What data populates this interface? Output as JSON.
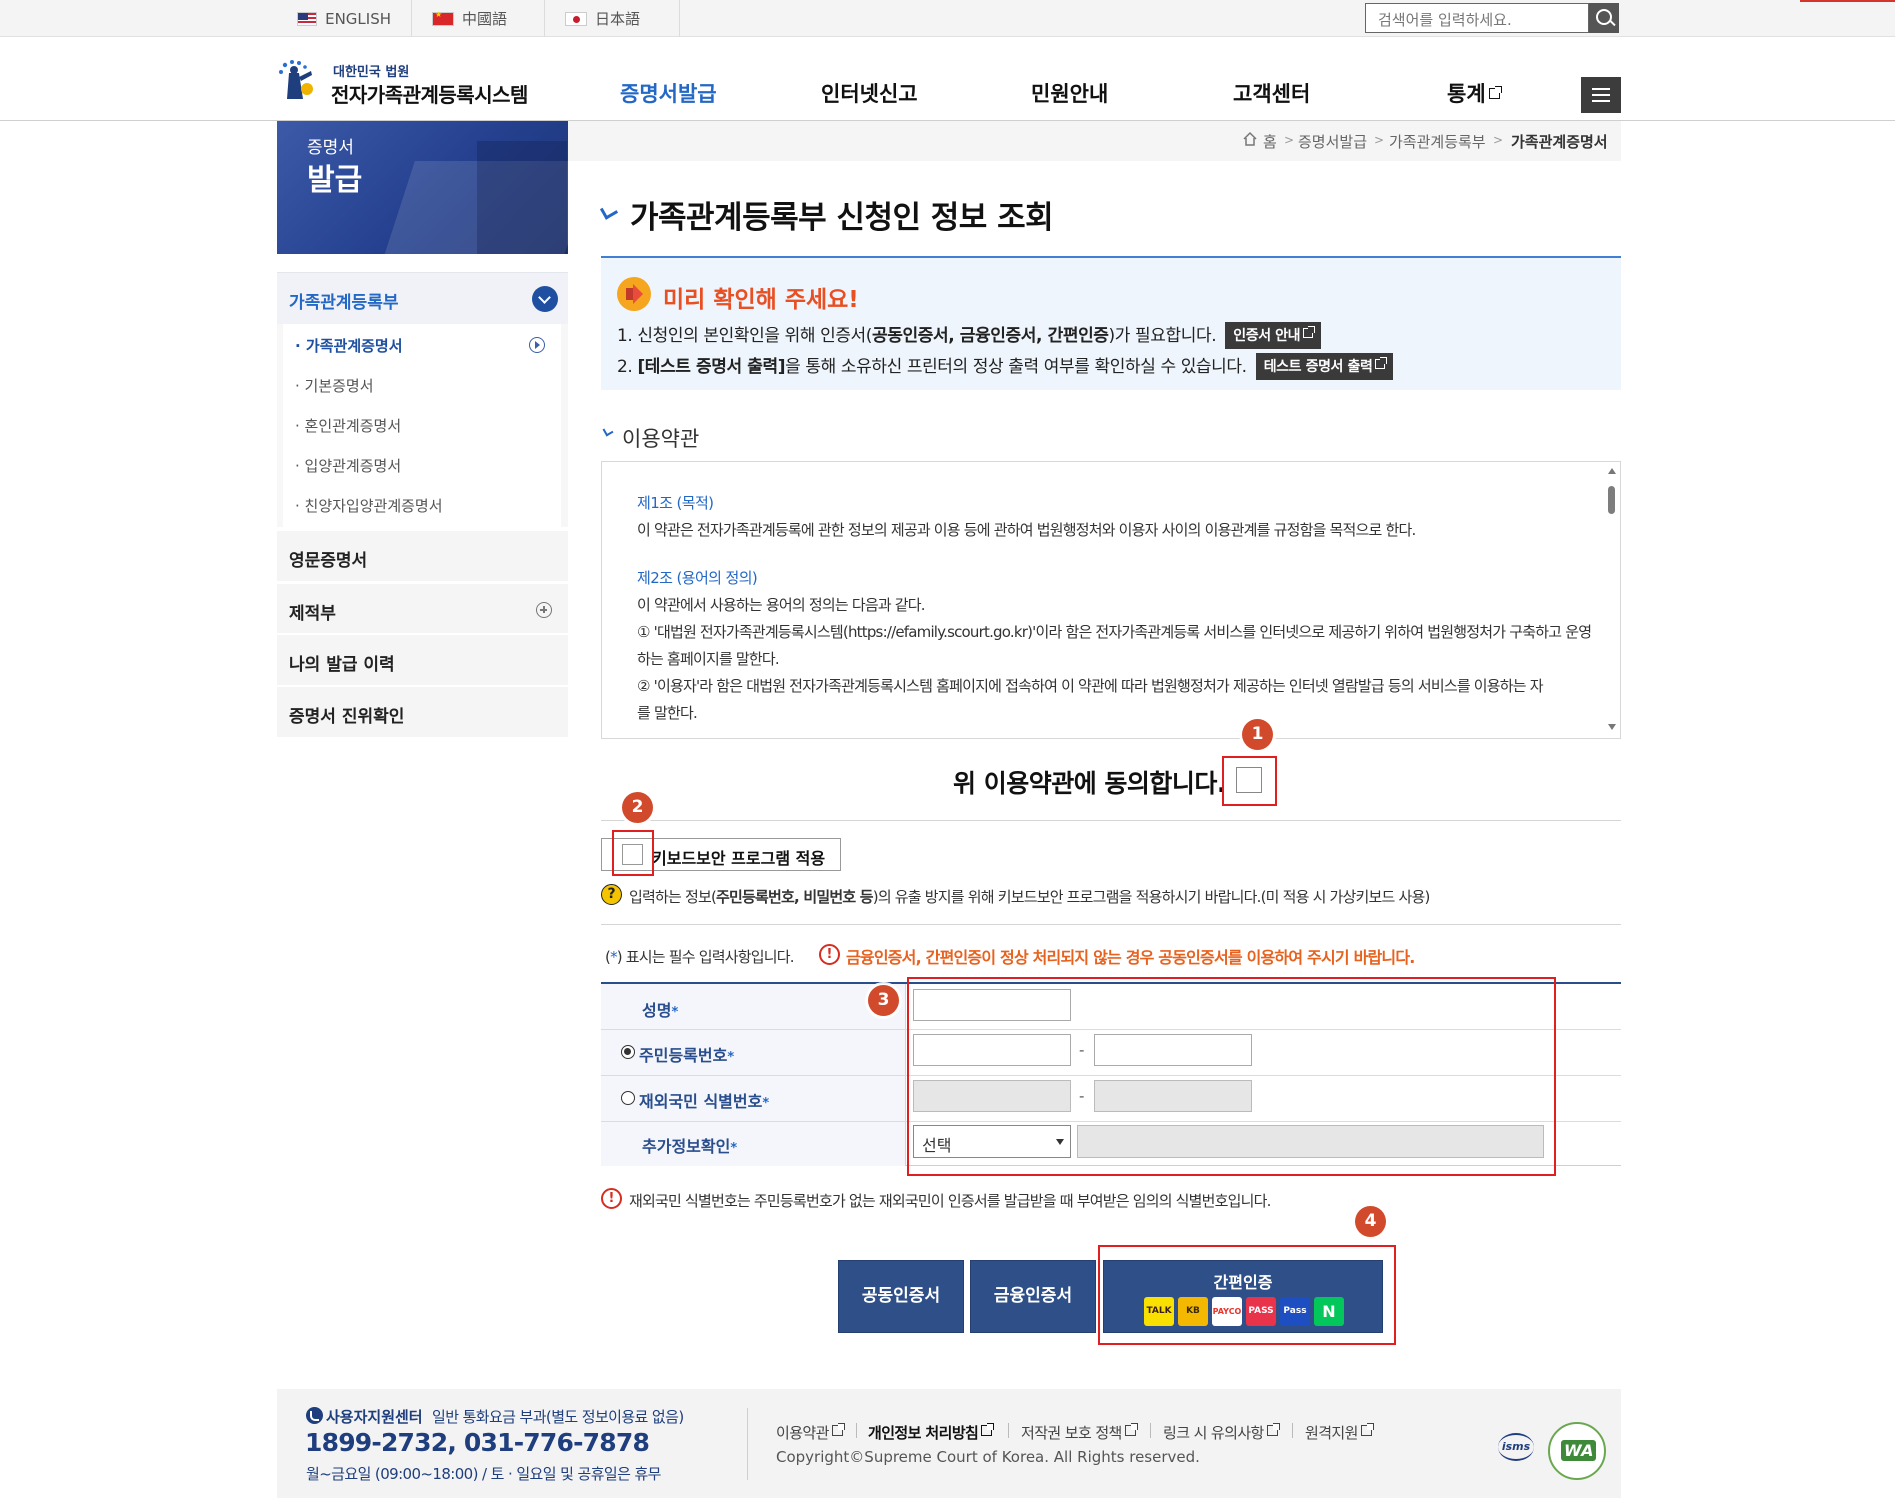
{
  "colors": {
    "brand_blue": "#2468c6",
    "navy": "#2a4e8c",
    "button_blue": "#2e4f88",
    "warning_orange": "#e8621f",
    "annotation_red": "#e02020"
  },
  "topbar": {
    "languages": [
      "ENGLISH",
      "中國語",
      "日本語"
    ],
    "search_placeholder": "검색어를 입력하세요."
  },
  "header": {
    "logo_sub": "대한민국 법원",
    "logo_title": "전자가족관계등록시스템",
    "nav": [
      "증명서발급",
      "인터넷신고",
      "민원안내",
      "고객센터",
      "통계"
    ]
  },
  "sidebar": {
    "banner_line1": "증명서",
    "banner_line2": "발급",
    "group": "가족관계등록부",
    "sub_items": [
      "· 가족관계증명서",
      "· 기본증명서",
      "· 혼인관계증명서",
      "· 입양관계증명서",
      "· 친양자입양관계증명서"
    ],
    "main_items": [
      "영문증명서",
      "제적부",
      "나의 발급 이력",
      "증명서 진위확인"
    ]
  },
  "breadcrumb": [
    "홈",
    "증명서발급",
    "가족관계등록부",
    "가족관계증명서"
  ],
  "page_title": "가족관계등록부 신청인 정보 조회",
  "notice": {
    "title": "미리 확인해 주세요!",
    "line1_a": "1. 신청인의 본인확인을 위해 인증서(",
    "line1_b": "공동인증서, 금융인증서, 간편인증",
    "line1_c": ")가 필요합니다.",
    "line1_btn": "인증서 안내",
    "line2_a": "2. ",
    "line2_b": "[테스트 증명서 출력]",
    "line2_c": "을 통해 소유하신 프린터의 정상 출력 여부를 확인하실 수 있습니다.",
    "line2_btn": "테스트 증명서 출력"
  },
  "terms": {
    "section_title": "이용약관",
    "art1_title": "제1조 (목적)",
    "art1_text": "이 약관은 전자가족관계등록에 관한 정보의 제공과 이용 등에 관하여 법원행정처와 이용자 사이의 이용관계를 규정함을 목적으로 한다.",
    "art2_title": "제2조 (용어의 정의)",
    "art2_intro": "이 약관에서 사용하는 용어의 정의는 다음과 같다.",
    "art2_item1_a": "① '대법원 전자가족관계등록시스템(https://efamily.scourt.go.kr)'이라 함은 전자가족관계등록 서비스를 인터넷으로 제공하기 위하여 법원행정처가 구축하고 운영",
    "art2_item1_b": "하는 홈페이지를 말한다.",
    "art2_item2_a": "② '이용자'라 함은 대법원 전자가족관계등록시스템 홈페이지에 접속하여 이 약관에 따라 법원행정처가 제공하는 인터넷 열람발급 등의 서비스를 이용하는 자",
    "art2_item2_b": "를 말한다."
  },
  "agree_label": "위 이용약관에 동의합니다.",
  "keyboard": {
    "label": "키보드보안 프로그램 적용",
    "note_a": "입력하는 정보(",
    "note_b": "주민등록번호, 비밀번호 등",
    "note_c": ")의 유출 방지를 위해 키보드보안 프로그램을 적용하시기 바랍니다.(미 적용 시 가상키보드 사용)"
  },
  "form": {
    "req_note_a": "(",
    "req_star": "*",
    "req_note_b": ") 표시는 필수 입력사항입니다.",
    "warning": "금융인증서, 간편인증이 정상 처리되지 않는 경우 공동인증서를 이용하여 주시기 바랍니다.",
    "label_name": "성명",
    "label_rrn": "주민등록번호",
    "label_foreign": "재외국민 식별번호",
    "label_extra": "추가정보확인",
    "select_value": "선택",
    "id_note": "재외국민 식별번호는 주민등록번호가 없는 재외국민이 인증서를 발급받을 때 부여받은 임의의 식별번호입니다."
  },
  "cert_buttons": {
    "joint": "공동인증서",
    "financial": "금융인증서",
    "easy": "간편인증",
    "providers": [
      "TALK",
      "KB",
      "PAYCO",
      "PASS",
      "Pass",
      "N"
    ]
  },
  "annotations": [
    "1",
    "2",
    "3",
    "4"
  ],
  "footer": {
    "center": "사용자지원센터",
    "fee": "일반 통화요금 부과(별도 정보이용료 없음)",
    "phone": "1899-2732, 031-776-7878",
    "hours": "월~금요일 (09:00~18:00) / 토 · 일요일 및 공휴일은 휴무",
    "links": [
      "이용약관",
      "개인정보 처리방침",
      "저작권 보호 정책",
      "링크 시 유의사항",
      "원격지원"
    ],
    "copyright": "Copyright©Supreme Court of Korea. All Rights reserved.",
    "isms": "isms"
  }
}
